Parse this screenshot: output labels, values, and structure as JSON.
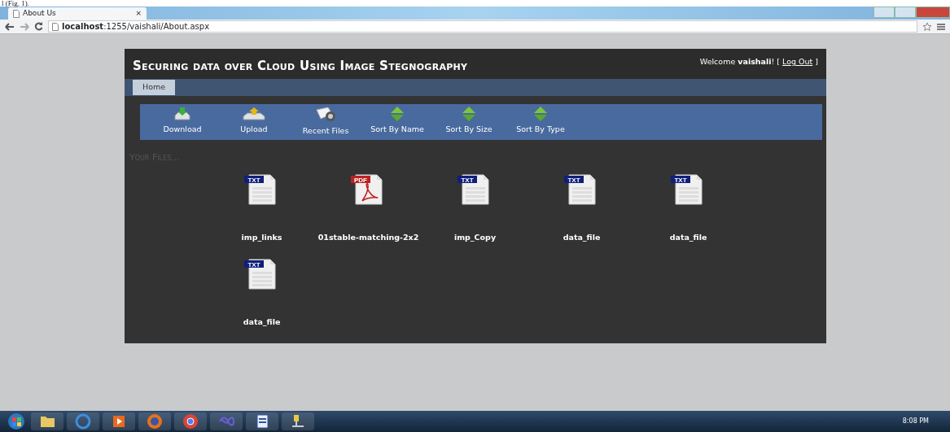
{
  "caption": "l (Fig. 1).",
  "browser": {
    "tab_title": "About Us",
    "tab_close": "×",
    "url_host": "localhost",
    "url_rest": ":1255/vaishali/About.aspx"
  },
  "site": {
    "title": "Securing data over Cloud Using Image Stegnography",
    "welcome": "Welcome ",
    "user": "vaishali",
    "after_user": "! [ ",
    "logout": "Log Out",
    "end": " ]"
  },
  "menu": [
    {
      "label": "Home",
      "selected": true
    }
  ],
  "toolbar": [
    {
      "kind": "download",
      "label": "Download"
    },
    {
      "kind": "upload",
      "label": "Upload"
    },
    {
      "kind": "recent",
      "label": "Recent Files"
    },
    {
      "kind": "sort",
      "label": "Sort By Name"
    },
    {
      "kind": "sort",
      "label": "Sort By Size"
    },
    {
      "kind": "sort",
      "label": "Sort By Type"
    }
  ],
  "section_title": "Your Files...",
  "files": [
    {
      "type": "TXT",
      "name": "imp_links"
    },
    {
      "type": "PDF",
      "name": "01stable-matching-2x2"
    },
    {
      "type": "TXT",
      "name": "imp_Copy"
    },
    {
      "type": "TXT",
      "name": "data_file"
    },
    {
      "type": "TXT",
      "name": "data_file"
    },
    {
      "type": "TXT",
      "name": "data_file"
    }
  ],
  "taskbar": {
    "clock": "8:08 PM"
  }
}
